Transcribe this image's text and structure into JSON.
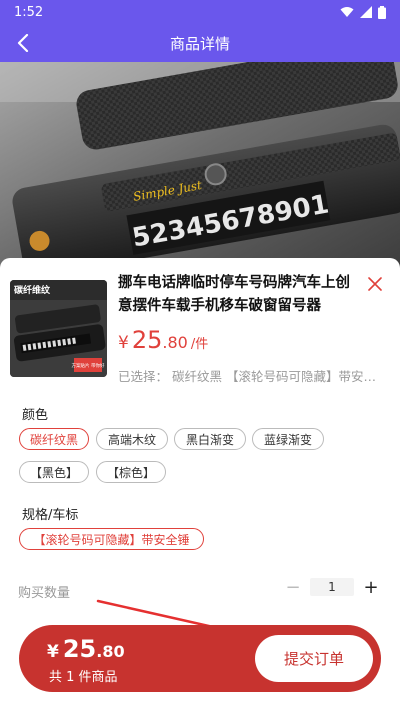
{
  "status_bar": {
    "time": "1:52"
  },
  "header": {
    "title": "商品详情"
  },
  "product": {
    "title": "挪车电话牌临时停车号码牌汽车上创意摆件车载手机移车破窗留号器",
    "thumb_label": "碳纤维纹",
    "thumb_tag": "方案贴片 带你好",
    "hero_plate": "52345678901",
    "hero_script": "Simple Just",
    "price": {
      "symbol": "¥",
      "int": "25",
      "dec": ".80",
      "unit": "/件"
    },
    "selected": "已选择： 碳纤纹黑 【滚轮号码可隐藏】带安全锤"
  },
  "color_section": {
    "label": "颜色",
    "options": [
      "碳纤纹黑",
      "高端木纹",
      "黑白渐变",
      "蓝绿渐变",
      "【黑色】",
      "【棕色】"
    ],
    "selected_index": 0
  },
  "spec_section": {
    "label": "规格/车标",
    "options": [
      "【滚轮号码可隐藏】带安全锤"
    ],
    "selected_index": 0
  },
  "quantity": {
    "label": "购买数量",
    "minus": "−",
    "value": "1",
    "plus": "+"
  },
  "footer": {
    "price_symbol": "¥",
    "price_int": "25",
    "price_dec": ".80",
    "count_text": "共 1 件商品",
    "submit_label": "提交订单"
  },
  "colors": {
    "accent": "#6a57ec",
    "price": "#e0413b",
    "footer": "#c7332f"
  }
}
